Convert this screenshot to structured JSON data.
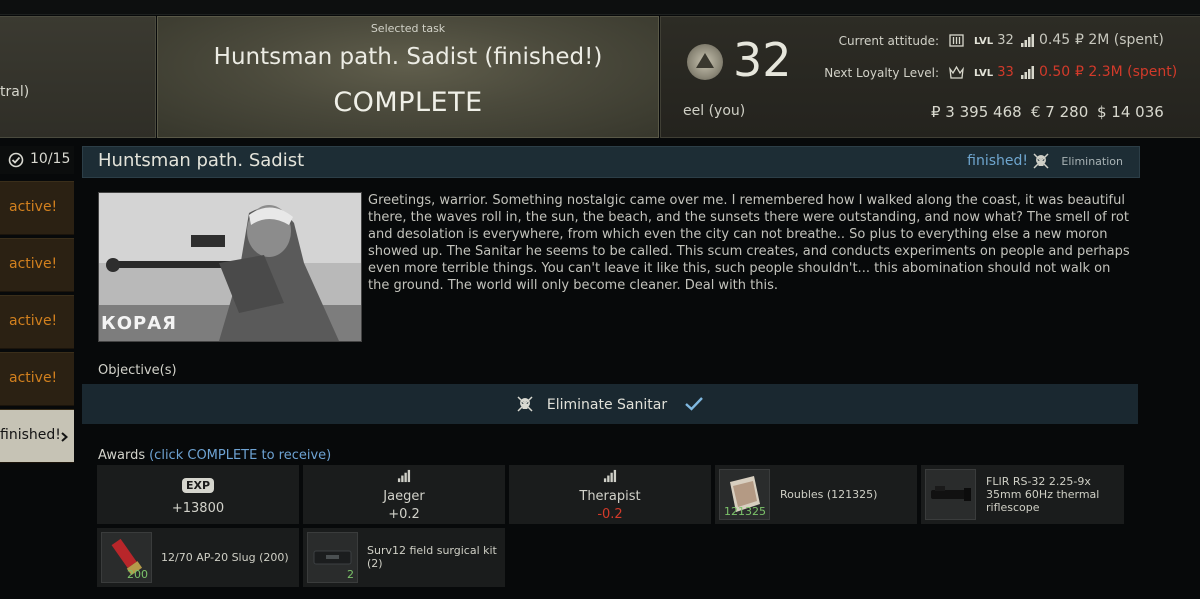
{
  "top_left_panel": {
    "partial_text": "tral)"
  },
  "selected_task": {
    "label": "Selected task",
    "name": "Huntsman path. Sadist (finished!)",
    "complete_button": "COMPLETE"
  },
  "trader": {
    "level": "32",
    "player": "eel (you)",
    "current": {
      "label": "Current attitude:",
      "lvl_prefix": "LVL",
      "lvl": "32",
      "rep": "0.45",
      "money": "₽ 2M (spent)"
    },
    "next": {
      "label": "Next Loyalty Level:",
      "lvl_prefix": "LVL",
      "lvl": "33",
      "rep": "0.50",
      "money": "₽ 2.3M (spent)"
    },
    "currency": {
      "roubles": "₽ 3 395 468",
      "euros": "€ 7 280",
      "dollars": "$ 14 036"
    }
  },
  "task_list": {
    "counter": "10/15",
    "tabs": [
      "active!",
      "active!",
      "active!",
      "active!",
      "finished!"
    ]
  },
  "task": {
    "title": "Huntsman path. Sadist",
    "status": "finished!",
    "type": "Elimination",
    "image_text": "КОРАЯ",
    "description": "Greetings, warrior. Something nostalgic came over me. I remembered how I walked along the coast, it was beautiful there, the waves roll in, the sun, the beach, and the sunsets there were outstanding, and now what? The smell of rot and desolation is everywhere, from which even the city can not breathe.. So plus to everything else a new moron showed up. The Sanitar he seems to be called. This scum creates, and conducts experiments on people and perhaps even more terrible things. You can't leave it like this, such people shouldn't... this abomination should not walk on the ground. The world will only become cleaner. Deal with this.",
    "objectives_label": "Objective(s)",
    "objectives": [
      "Eliminate Sanitar"
    ]
  },
  "awards": {
    "label": "Awards",
    "hint": "(click COMPLETE to receive)",
    "exp_badge": "EXP",
    "exp": "+13800",
    "rep1_name": "Jaeger",
    "rep1_val": "+0.2",
    "rep2_name": "Therapist",
    "rep2_val": "-0.2",
    "roubles_label": "Roubles (121325)",
    "roubles_count": "121325",
    "scope_label": "FLIR RS-32 2.25-9x 35mm 60Hz thermal riflescope",
    "slug_label": "12/70 AP-20 Slug (200)",
    "slug_count": "200",
    "kit_label": "Surv12 field surgical kit (2)",
    "kit_count": "2"
  },
  "colors": {
    "active": "#d2801e",
    "finished_status": "#6fa6cf",
    "negative": "#d23a2a",
    "count": "#7cc36a"
  }
}
